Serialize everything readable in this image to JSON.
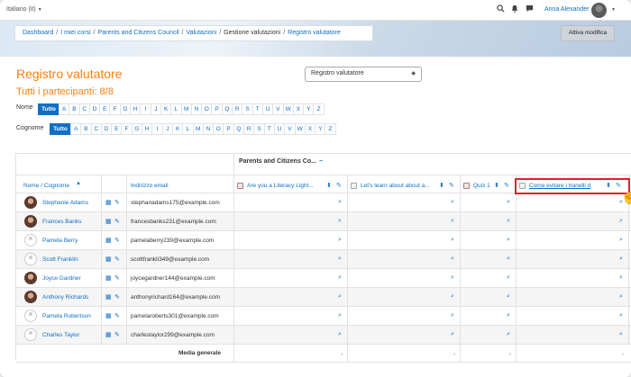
{
  "topbar": {
    "language": "Italiano (it)",
    "user_name": "Anna Alexander"
  },
  "breadcrumb": [
    "Dashboard",
    "I miei corsi",
    "Parents and Citizens Council",
    "Valutazioni",
    "Gestione valutazioni",
    "Registro valutatore"
  ],
  "edit_button": "Attiva modifica",
  "page_title": "Registro valutatore",
  "subtitle": "Tutti i partecipanti: 8/8",
  "report_select": "Registro valutatore",
  "filters": {
    "first_name_label": "Nome",
    "last_name_label": "Cognome",
    "all_label": "Tutto",
    "letters": [
      "A",
      "B",
      "C",
      "D",
      "E",
      "F",
      "G",
      "H",
      "I",
      "J",
      "K",
      "L",
      "M",
      "N",
      "O",
      "P",
      "Q",
      "R",
      "S",
      "T",
      "U",
      "V",
      "W",
      "X",
      "Y",
      "Z"
    ]
  },
  "table": {
    "category": "Parents and Citizens Co...",
    "category_toggle": "−",
    "col_name": "Nome / Cognome",
    "col_email": "Indirizzo email",
    "grade_items": [
      "Are you a Literacy Light...",
      "Let's learn about about a...",
      "Quiz 1",
      "Come evitare i tranelli d"
    ],
    "rows": [
      {
        "name": "Stephanie Adams",
        "email": "stephanadams175@example.com",
        "photo": true
      },
      {
        "name": "Frances Banks",
        "email": "francesbanks231@example.com",
        "photo": true
      },
      {
        "name": "Pamela Berry",
        "email": "pamelaberry239@example.com",
        "photo": false
      },
      {
        "name": "Scott Franklin",
        "email": "scottfrankli349@example.com",
        "photo": false
      },
      {
        "name": "Joyce Gardner",
        "email": "joycegardner144@example.com",
        "photo": true
      },
      {
        "name": "Anthony Richards",
        "email": "anthonyrichard164@example.com",
        "photo": true
      },
      {
        "name": "Pamela Robertson",
        "email": "pamelaroberts301@example.com",
        "photo": false
      },
      {
        "name": "Charles Taylor",
        "email": "charlestaylor299@example.com",
        "photo": false
      }
    ],
    "empty_grade": "-",
    "average_label": "Media generale"
  },
  "colors": {
    "accent": "#0f6fc5",
    "title": "#f98012",
    "highlight": "#d9232d"
  }
}
